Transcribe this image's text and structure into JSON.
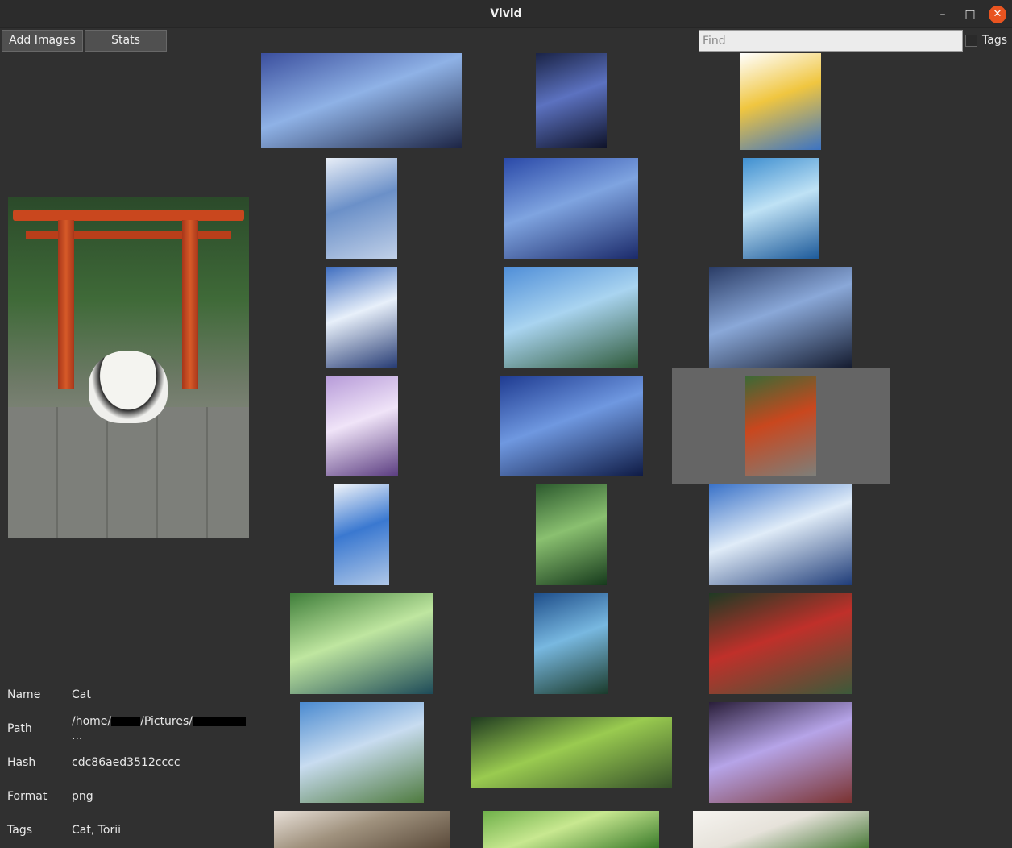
{
  "window": {
    "title": "Vivid"
  },
  "toolbar": {
    "add_images": "Add Images",
    "stats": "Stats",
    "find_placeholder": "Find",
    "tags_label": "Tags"
  },
  "details": {
    "name_label": "Name",
    "name": "Cat",
    "path_label": "Path",
    "path_a": "/home/",
    "path_b": "/Pictures/",
    "path_more": "...",
    "hash_label": "Hash",
    "hash": "cdc86aed3512cccc",
    "format_label": "Format",
    "format": "png",
    "tags_label": "Tags",
    "tags": "Cat, Torii"
  },
  "thumbnails": [
    {
      "name": "thumb-city-sky",
      "colors": [
        "#3b4f9e",
        "#8fb2e6",
        "#1c2444"
      ]
    },
    {
      "name": "thumb-book-cover-stars",
      "colors": [
        "#1a2346",
        "#5c72c0",
        "#0e1228"
      ]
    },
    {
      "name": "thumb-flyer-page",
      "colors": [
        "#ffffff",
        "#f0c640",
        "#3b73c4"
      ]
    },
    {
      "name": "thumb-book-cover-sky",
      "colors": [
        "#e8eef7",
        "#6b90c8",
        "#c0d0e8"
      ]
    },
    {
      "name": "thumb-swing-dusk",
      "colors": [
        "#2a49a8",
        "#7fa4e0",
        "#1b2a6a"
      ]
    },
    {
      "name": "thumb-whale-wave",
      "colors": [
        "#3f8fd0",
        "#bfe2f5",
        "#1d5a9a"
      ]
    },
    {
      "name": "thumb-street-clouds",
      "colors": [
        "#3f6ec0",
        "#e8f0fa",
        "#273c74"
      ]
    },
    {
      "name": "thumb-pagoda-town",
      "colors": [
        "#4f8ed8",
        "#a9d4f0",
        "#2f5a3a"
      ]
    },
    {
      "name": "thumb-window-hall",
      "colors": [
        "#2a3c66",
        "#8aa8d8",
        "#151c30"
      ]
    },
    {
      "name": "thumb-music-room",
      "colors": [
        "#b69ad8",
        "#f0e4f8",
        "#5a3c80"
      ]
    },
    {
      "name": "thumb-night-trees",
      "colors": [
        "#1e3a90",
        "#6f98e0",
        "#0e1a44"
      ]
    },
    {
      "name": "thumb-torii-cat-selected",
      "colors": [
        "#3a6a36",
        "#c9471e",
        "#7d7f7a"
      ]
    },
    {
      "name": "thumb-app-layout",
      "colors": [
        "#f0f4fa",
        "#3a78d0",
        "#b0c8e8"
      ]
    },
    {
      "name": "thumb-green-alley",
      "colors": [
        "#2c5a2e",
        "#8ac070",
        "#163a1c"
      ]
    },
    {
      "name": "thumb-ruined-station",
      "colors": [
        "#3a72c8",
        "#e0ecf8",
        "#1f3c78"
      ]
    },
    {
      "name": "thumb-flooded-corridor",
      "colors": [
        "#3f7e3a",
        "#bfe6a0",
        "#1d4a58"
      ]
    },
    {
      "name": "thumb-blue-tunnel",
      "colors": [
        "#1e4e8a",
        "#78b8e0",
        "#1a3a2a"
      ]
    },
    {
      "name": "thumb-forest-tunnel",
      "colors": [
        "#1f3a24",
        "#c0302a",
        "#3c5a3a"
      ]
    },
    {
      "name": "thumb-dam-girl",
      "colors": [
        "#4a8ad0",
        "#c8dcf0",
        "#4e7a3e"
      ]
    },
    {
      "name": "thumb-piano-ruins",
      "colors": [
        "#1f3a20",
        "#9acb50",
        "#36522a"
      ]
    },
    {
      "name": "thumb-purple-hall",
      "colors": [
        "#2a1e3a",
        "#b6a4e8",
        "#7a3230"
      ]
    },
    {
      "name": "thumb-interior-door",
      "colors": [
        "#e8e0d8",
        "#a0927e",
        "#5a4a3a"
      ]
    },
    {
      "name": "thumb-grass-field",
      "colors": [
        "#6fb04a",
        "#c8e890",
        "#3a7a2a"
      ]
    },
    {
      "name": "thumb-white-sketch",
      "colors": [
        "#f6f4f0",
        "#e6e2da",
        "#4a7a3a"
      ]
    }
  ]
}
